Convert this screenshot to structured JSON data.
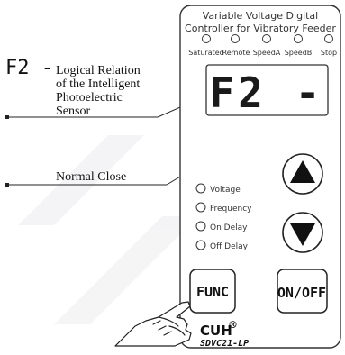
{
  "panel": {
    "title_line1": "Variable Voltage Digital",
    "title_line2": "Controller for Vibratory Feeder",
    "indicators": [
      "Saturated",
      "Remote",
      "SpeedA",
      "SpeedB",
      "Stop"
    ],
    "display_value": "F2 -",
    "param_leds": [
      "Voltage",
      "Frequency",
      "On Delay",
      "Off Delay"
    ],
    "func_label": "FUNC",
    "onoff_label": "ON/OFF",
    "brand": "CUH",
    "brand_mark": "®",
    "model": "SDVC21-LP"
  },
  "callouts": {
    "code": "F2 -",
    "line1": "Logical Relation",
    "line2": "of the Intelligent",
    "line3": "Photoelectric",
    "line4": "Sensor",
    "lower": "Normal Close"
  }
}
